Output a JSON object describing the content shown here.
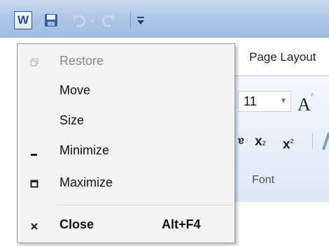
{
  "quick_access_toolbar": {
    "app_icon_letter": "W",
    "icons": [
      "word-app-icon",
      "save-icon",
      "undo-icon",
      "redo-icon",
      "customize-toolbar-icon"
    ]
  },
  "ribbon": {
    "tab_page_layout": "Page Layout",
    "font_size": "11",
    "grow_font_glyph": "A",
    "grow_font_mark": "^",
    "strikethrough_glyph": "ɐ",
    "subscript_glyph": "x",
    "subscript_mark": "2",
    "superscript_glyph": "x",
    "superscript_mark": "2",
    "font_group_label": "Font"
  },
  "system_menu": {
    "items": [
      {
        "label": "Restore",
        "enabled": false,
        "icon": "restore-icon"
      },
      {
        "label": "Move",
        "enabled": true,
        "icon": ""
      },
      {
        "label": "Size",
        "enabled": true,
        "icon": ""
      },
      {
        "label": "Minimize",
        "enabled": true,
        "icon": "minimize-icon"
      },
      {
        "label": "Maximize",
        "enabled": true,
        "icon": "maximize-icon"
      },
      {
        "label": "Close",
        "enabled": true,
        "icon": "close-icon",
        "shortcut": "Alt+F4"
      }
    ]
  },
  "colors": {
    "title_bar": "#aac4e6",
    "menu_background": "#f3f3f3",
    "disabled_text": "#8a8a8a",
    "word_blue": "#1e4fa4"
  }
}
